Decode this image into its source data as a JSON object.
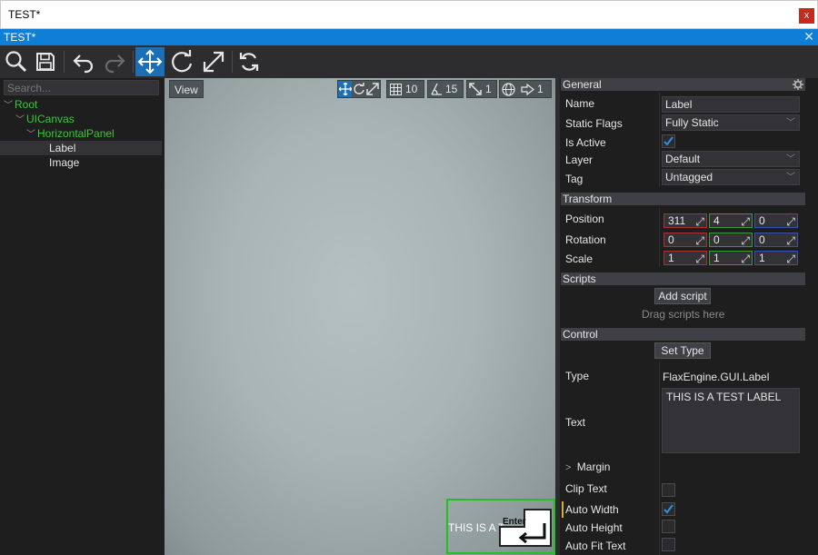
{
  "window": {
    "title": "TEST*",
    "close_glyph": "x"
  },
  "tab": {
    "title": "TEST*",
    "close_glyph": "✕"
  },
  "toolbar": {
    "icons": [
      "search-icon",
      "save-icon",
      "undo-icon",
      "redo-icon",
      "translate-gizmo-icon",
      "rotate-gizmo-icon",
      "scale-gizmo-icon",
      "refresh-icon"
    ],
    "active": "translate-gizmo-icon",
    "accent": "#1a6fb8"
  },
  "hierarchy": {
    "search_placeholder": "Search...",
    "nodes": [
      {
        "label": "Root",
        "level": 0,
        "expanded": true
      },
      {
        "label": "UICanvas",
        "level": 1,
        "expanded": true
      },
      {
        "label": "HorizontalPanel",
        "level": 2,
        "expanded": true
      },
      {
        "label": "Label",
        "level": 3,
        "selected": true
      },
      {
        "label": "Image",
        "level": 3
      }
    ]
  },
  "viewport": {
    "view_label": "View",
    "grid_value": "10",
    "angle_value": "15",
    "scale_value": "1",
    "speed_value": "1",
    "label_preview": "THIS IS A T",
    "enter_key": "Enter"
  },
  "properties": {
    "general": {
      "header": "General",
      "name_label": "Name",
      "name_value": "Label",
      "static_flags_label": "Static Flags",
      "static_flags_value": "Fully Static",
      "is_active_label": "Is Active",
      "is_active": true,
      "layer_label": "Layer",
      "layer_value": "Default",
      "tag_label": "Tag",
      "tag_value": "Untagged"
    },
    "transform": {
      "header": "Transform",
      "position_label": "Position",
      "position": [
        "311",
        "4",
        "0"
      ],
      "rotation_label": "Rotation",
      "rotation": [
        "0",
        "0",
        "0"
      ],
      "scale_label": "Scale",
      "scale": [
        "1",
        "1",
        "1"
      ]
    },
    "scripts": {
      "header": "Scripts",
      "add_button": "Add script",
      "hint": "Drag scripts here"
    },
    "control": {
      "header": "Control",
      "set_type_button": "Set Type",
      "type_label": "Type",
      "type_value": "FlaxEngine.GUI.Label",
      "text_label": "Text",
      "text_value": "THIS IS A TEST LABEL",
      "margin_label": "Margin",
      "clip_text_label": "Clip Text",
      "clip_text": false,
      "auto_width_label": "Auto Width",
      "auto_width": true,
      "auto_height_label": "Auto Height",
      "auto_height": false,
      "auto_fit_text_label": "Auto Fit Text",
      "auto_fit_text": false
    }
  }
}
